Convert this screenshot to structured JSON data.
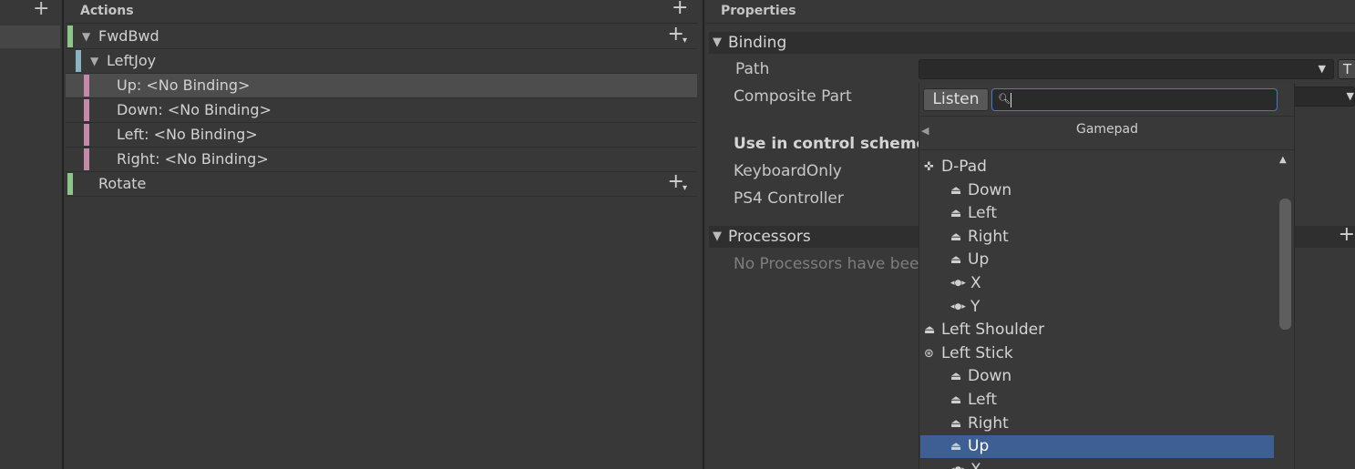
{
  "maps": {
    "add_label": "+"
  },
  "actions": {
    "header": "Actions",
    "add_label": "+",
    "rows": [
      {
        "label": "FwdBwd",
        "bar_color": "#8fc48a",
        "expanded": true,
        "plus": "+"
      },
      {
        "label": "LeftJoy",
        "bar_color": "#8ab3c4",
        "expanded": true
      },
      {
        "label": "Up: <No Binding>",
        "bar_color": "#c48aa8",
        "selected": true
      },
      {
        "label": "Down: <No Binding>",
        "bar_color": "#c48aa8"
      },
      {
        "label": "Left: <No Binding>",
        "bar_color": "#c48aa8"
      },
      {
        "label": "Right: <No Binding>",
        "bar_color": "#c48aa8"
      },
      {
        "label": "Rotate",
        "bar_color": "#8fc48a",
        "plus": "+"
      }
    ]
  },
  "properties": {
    "header": "Properties",
    "binding_section": "Binding",
    "path_label": "Path",
    "composite_part_label": "Composite Part",
    "t_button": "T",
    "use_in_schemes_label": "Use in control scheme",
    "schemes": [
      "KeyboardOnly",
      "PS4 Controller"
    ],
    "processors_section": "Processors",
    "processors_add": "+",
    "no_processors_text": "No Processors have bee"
  },
  "dropdown": {
    "listen_label": "Listen",
    "search_value": "",
    "title": "Gamepad",
    "items": [
      {
        "label": "D-Pad",
        "icon": "dpad-icon",
        "indent": 0
      },
      {
        "label": "Down",
        "icon": "button-icon",
        "indent": 1
      },
      {
        "label": "Left",
        "icon": "button-icon",
        "indent": 1
      },
      {
        "label": "Right",
        "icon": "button-icon",
        "indent": 1
      },
      {
        "label": "Up",
        "icon": "button-icon",
        "indent": 1
      },
      {
        "label": "X",
        "icon": "axis-icon",
        "indent": 1
      },
      {
        "label": "Y",
        "icon": "axis-icon",
        "indent": 1
      },
      {
        "label": "Left Shoulder",
        "icon": "button-icon",
        "indent": 0
      },
      {
        "label": "Left Stick",
        "icon": "stick-icon",
        "indent": 0
      },
      {
        "label": "Down",
        "icon": "button-icon",
        "indent": 1
      },
      {
        "label": "Left",
        "icon": "button-icon",
        "indent": 1
      },
      {
        "label": "Right",
        "icon": "button-icon",
        "indent": 1
      },
      {
        "label": "Up",
        "icon": "button-icon",
        "indent": 1,
        "selected": true
      },
      {
        "label": "X",
        "icon": "axis-icon",
        "indent": 1
      }
    ]
  },
  "icons": {
    "dpad-icon": "✜",
    "button-icon": "⏏",
    "axis-icon": "◂●▸",
    "stick-icon": "⊛"
  }
}
